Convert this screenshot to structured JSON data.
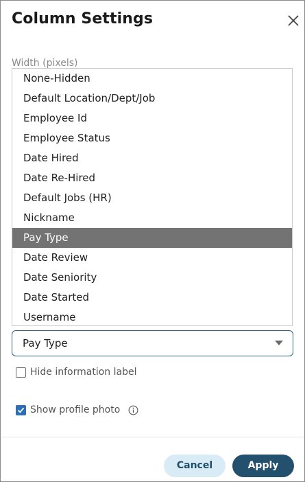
{
  "dialog": {
    "title": "Column Settings",
    "close_icon": "close-icon"
  },
  "width_field": {
    "label": "Width (pixels)"
  },
  "dropdown": {
    "options": [
      "None-Hidden",
      "Default Location/Dept/Job",
      "Employee Id",
      "Employee Status",
      "Date Hired",
      "Date Re-Hired",
      "Default Jobs (HR)",
      "Nickname",
      "Pay Type",
      "Date Review",
      "Date Seniority",
      "Date Started",
      "Username"
    ],
    "selected_index": 8,
    "selected_value": "Pay Type"
  },
  "hide_info": {
    "label": "Hide information label",
    "checked": false
  },
  "show_photo": {
    "label": "Show profile photo",
    "checked": true,
    "info_icon": "info-icon"
  },
  "footer": {
    "cancel_label": "Cancel",
    "apply_label": "Apply"
  },
  "colors": {
    "accent": "#23506c",
    "selected_option_bg": "#737373",
    "checkbox_on": "#2d6fb7",
    "cancel_bg": "#d9ecf5"
  }
}
